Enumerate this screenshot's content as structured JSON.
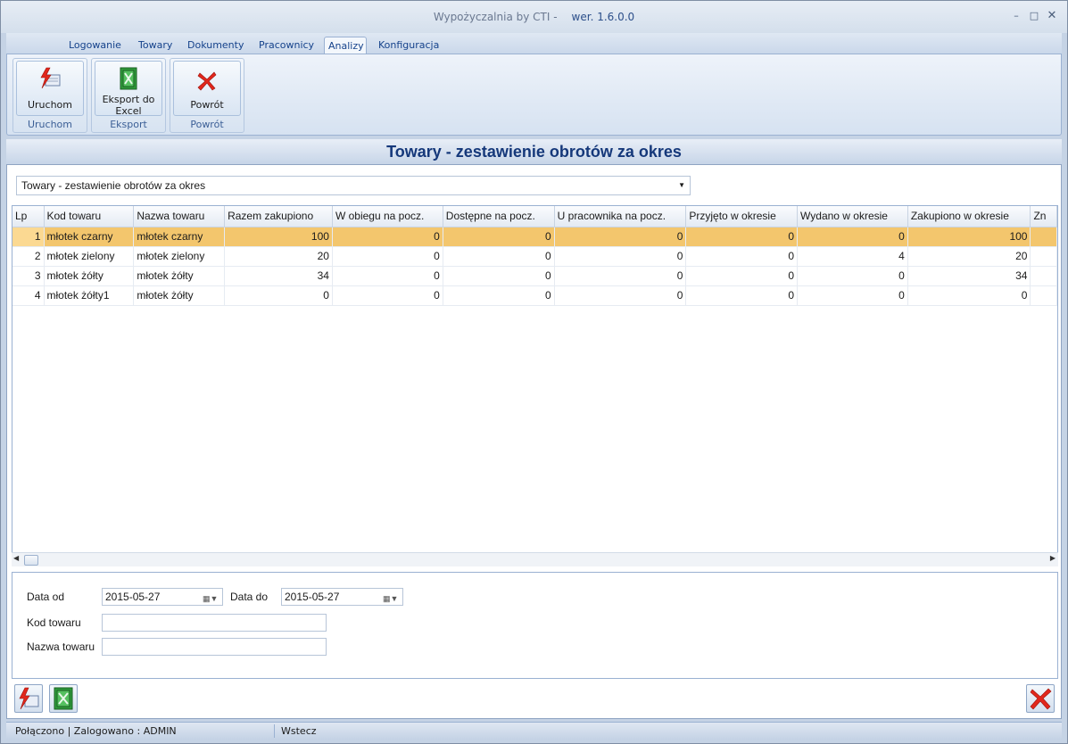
{
  "window": {
    "title": "Wypożyczalnia by CTI -",
    "version": "wer. 1.6.0.0"
  },
  "tabs": [
    {
      "label": "Logowanie"
    },
    {
      "label": "Towary"
    },
    {
      "label": "Dokumenty"
    },
    {
      "label": "Pracownicy"
    },
    {
      "label": "Analizy",
      "active": true
    },
    {
      "label": "Konfiguracja"
    }
  ],
  "ribbon": {
    "run_label": "Uruchom",
    "run_group": "Uruchom",
    "export_label_1": "Eksport do",
    "export_label_2": "Excel",
    "export_group": "Eksport",
    "back_label": "Powrót",
    "back_group": "Powrót"
  },
  "page_title": "Towary - zestawienie obrotów za okres",
  "report_select": {
    "value": "Towary - zestawienie obrotów za okres"
  },
  "grid": {
    "columns": [
      "Lp",
      "Kod towaru",
      "Nazwa towaru",
      "Razem zakupiono",
      "W obiegu na pocz.",
      "Dostępne na pocz.",
      "U pracownika na pocz.",
      "Przyjęto w okresie",
      "Wydano w okresie",
      "Zakupiono w okresie",
      "Zn"
    ],
    "rows": [
      [
        "1",
        "młotek czarny",
        "młotek czarny",
        "100",
        "0",
        "0",
        "0",
        "0",
        "0",
        "100"
      ],
      [
        "2",
        "młotek zielony",
        "młotek zielony",
        "20",
        "0",
        "0",
        "0",
        "0",
        "4",
        "20"
      ],
      [
        "3",
        "młotek żółty",
        "młotek żółty",
        "34",
        "0",
        "0",
        "0",
        "0",
        "0",
        "34"
      ],
      [
        "4",
        "młotek żółty1",
        "młotek żółty",
        "0",
        "0",
        "0",
        "0",
        "0",
        "0",
        "0"
      ]
    ],
    "selected_row": 0
  },
  "filters": {
    "date_from_label": "Data od",
    "date_from": "2015-05-27",
    "date_to_label": "Data do",
    "date_to": "2015-05-27",
    "code_label": "Kod towaru",
    "code_value": "",
    "name_label": "Nazwa towaru",
    "name_value": ""
  },
  "status": {
    "connection": "Połączono | Zalogowano : ADMIN",
    "back": "Wstecz"
  },
  "colors": {
    "selected_row": "#f3c66d",
    "title_text": "#15387a",
    "ribbon_label": "#3b5f96"
  }
}
